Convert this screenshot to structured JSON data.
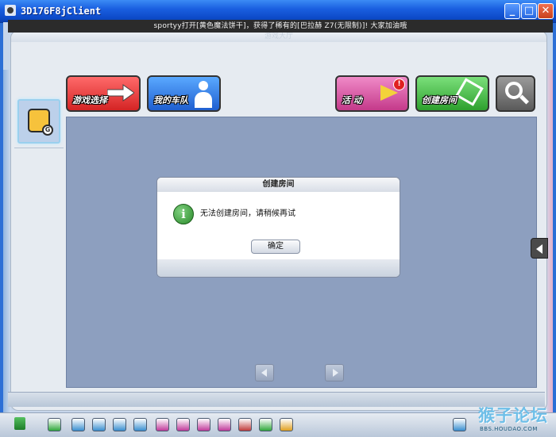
{
  "window": {
    "title": "3D176F8jClient"
  },
  "frame": {
    "header_text": "游戏大厅"
  },
  "ticker": {
    "text": "sportyy打开[黄色魔法饼干]，获得了稀有的[巴拉赫 Z7(无限制)]! 大家加油哦"
  },
  "toolbar": {
    "game_select": "游戏选择",
    "my_team": "我的车队",
    "activity": "活  动",
    "activity_badge": "!",
    "create_room": "创建房间"
  },
  "dialog": {
    "title": "创建房间",
    "message": "无法创建房间，请稍候再试",
    "ok_label": "确定",
    "icon_glyph": "i"
  },
  "taskbar": {
    "icons": [
      {
        "name": "back-icon",
        "color": "#2fa83a"
      },
      {
        "name": "cart-icon",
        "color": "#3a8fd0"
      },
      {
        "name": "home-icon",
        "color": "#3a8fd0"
      },
      {
        "name": "wrench-icon",
        "color": "#3a8fd0"
      },
      {
        "name": "card-icon",
        "color": "#3a8fd0"
      },
      {
        "name": "gift-icon",
        "color": "#c03a9a"
      },
      {
        "name": "hand-icon",
        "color": "#c03a9a"
      },
      {
        "name": "heart-icon",
        "color": "#c03a9a"
      },
      {
        "name": "book-icon",
        "color": "#c03a9a"
      },
      {
        "name": "stars-icon",
        "color": "#c03a3a"
      },
      {
        "name": "chat-icon",
        "color": "#2fa83a"
      },
      {
        "name": "pencil-icon",
        "color": "#e0a020"
      },
      {
        "name": "settings-icon",
        "color": "#3a8fd0"
      }
    ],
    "watermark_main": "猴子论坛",
    "watermark_sub": "BBS.HOUDAO.COM"
  },
  "colors": {
    "titlebar": "#1a5fe0",
    "panel": "#8d9fbf",
    "ticker_bg": "#2b2b2b"
  }
}
